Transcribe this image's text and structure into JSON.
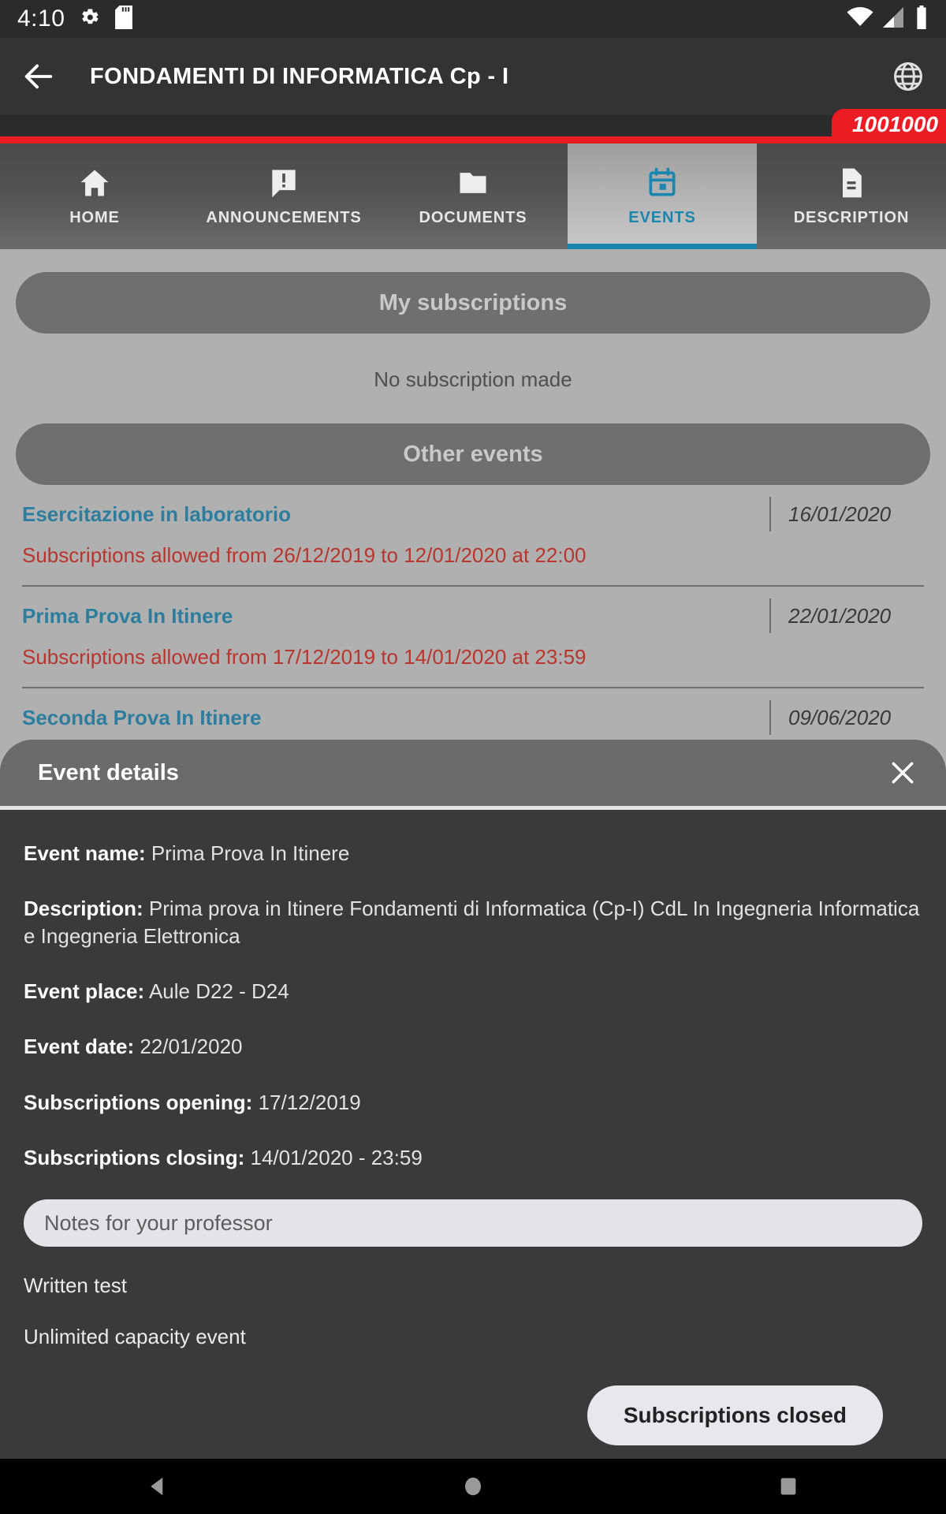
{
  "status_bar": {
    "time": "4:10",
    "icons": [
      "gear-icon",
      "sd-card-icon",
      "wifi-icon",
      "cellular-signal-icon",
      "battery-icon"
    ]
  },
  "app_bar": {
    "back_label": "back-arrow-icon",
    "title": "FONDAMENTI DI INFORMATICA Cp - I",
    "language_icon": "globe-icon"
  },
  "badge": {
    "text": "1001000",
    "color": "#ec1c24"
  },
  "tabs": [
    {
      "label": "HOME",
      "icon": "home-icon",
      "active": false
    },
    {
      "label": "ANNOUNCEMENTS",
      "icon": "announcement-icon",
      "active": false
    },
    {
      "label": "DOCUMENTS",
      "icon": "folder-icon",
      "active": false
    },
    {
      "label": "EVENTS",
      "icon": "calendar-icon",
      "active": true
    },
    {
      "label": "DESCRIPTION",
      "icon": "document-icon",
      "active": false
    }
  ],
  "accent_color": "#1a86b0",
  "events_page": {
    "my_subscriptions_label": "My subscriptions",
    "no_subscription_text": "No subscription made",
    "other_events_label": "Other events",
    "events": [
      {
        "name": "Esercitazione in laboratorio",
        "date": "16/01/2020",
        "subscription_window": "Subscriptions allowed from 26/12/2019 to 12/01/2020 at 22:00"
      },
      {
        "name": "Prima Prova In Itinere",
        "date": "22/01/2020",
        "subscription_window": "Subscriptions allowed from 17/12/2019 to 14/01/2020 at 23:59"
      },
      {
        "name": "Seconda Prova In Itinere",
        "date": "09/06/2020",
        "subscription_window": ""
      }
    ]
  },
  "event_details": {
    "title": "Event details",
    "close_icon": "close-icon",
    "fields": [
      {
        "label": "Event name:",
        "value": "Prima Prova In Itinere"
      },
      {
        "label": "Description:",
        "value": "Prima prova in Itinere Fondamenti di Informatica (Cp-I) CdL In Ingegneria Informatica e Ingegneria Elettronica"
      },
      {
        "label": "Event place:",
        "value": "Aule D22 - D24"
      },
      {
        "label": "Event date:",
        "value": "22/01/2020"
      },
      {
        "label": "Subscriptions opening:",
        "value": "17/12/2019"
      },
      {
        "label": "Subscriptions closing:",
        "value": "14/01/2020 - 23:59"
      }
    ],
    "notes_placeholder": "Notes for your professor",
    "notes_value": "",
    "exam_type": "Written test",
    "capacity": "Unlimited capacity event",
    "action_button": "Subscriptions closed"
  },
  "nav_bar": {
    "back": "nav-back-icon",
    "home": "nav-home-icon",
    "recents": "nav-recents-icon"
  }
}
